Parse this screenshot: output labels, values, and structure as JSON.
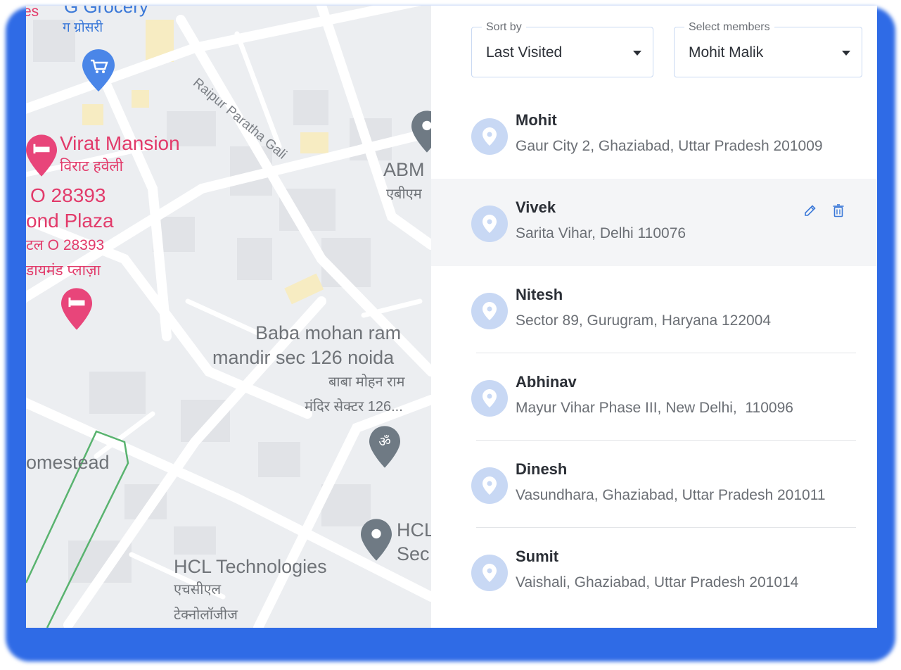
{
  "map": {
    "labels": {
      "grocery_en": "G Grocery",
      "grocery_hi": "ग ग्रोसरी",
      "street": "Raipur Paratha Gali",
      "virat_en": "Virat Mansion",
      "virat_hi": "विराट हवेली",
      "o_number": "O 28393",
      "plaza": "ond Plaza",
      "o_number_hi": "टल O 28393",
      "diamond_hi": "डायमंड प्लाज़ा",
      "abm_en": "ABM",
      "abm_hi": "एबीएम",
      "temple_en_1": "Baba mohan ram",
      "temple_en_2": "mandir sec 126 noida",
      "temple_hi_1": "बाबा मोहन राम",
      "temple_hi_2": "मंदिर सेक्टर 126...",
      "homestead": "omestead",
      "hcl_sec_1": "HCL",
      "hcl_sec_2": "Sec",
      "hcl_en": "HCL Technologies",
      "hcl_hi_1": "एचसीएल",
      "hcl_hi_2": "टेक्नोलॉजीज",
      "edge_es": "es"
    },
    "icons": [
      "shopping-cart-pin-icon",
      "hotel-pin-icon",
      "hotel-pin-icon",
      "temple-pin-icon",
      "place-pin-icon",
      "place-pin-icon"
    ]
  },
  "filters": {
    "sort_legend": "Sort by",
    "sort_value": "Last Visited",
    "members_legend": "Select members",
    "members_value": "Mohit Malik"
  },
  "locations": [
    {
      "name": "Mohit",
      "address": "Gaur City 2, Ghaziabad, Uttar Pradesh 201009"
    },
    {
      "name": "Vivek",
      "address": "Sarita Vihar, Delhi 110076"
    },
    {
      "name": "Nitesh",
      "address": "Sector 89, Gurugram, Haryana 122004"
    },
    {
      "name": "Abhinav",
      "address": "Mayur Vihar Phase III, New Delhi,  110096"
    },
    {
      "name": "Dinesh",
      "address": "Vasundhara, Ghaziabad, Uttar Pradesh 201011"
    },
    {
      "name": "Sumit",
      "address": "Vaishali, Ghaziabad, Uttar Pradesh 201014"
    }
  ],
  "colors": {
    "accent": "#2f6be6",
    "pin_bg": "#c8d8f4",
    "action_icon": "#3a78d8"
  }
}
